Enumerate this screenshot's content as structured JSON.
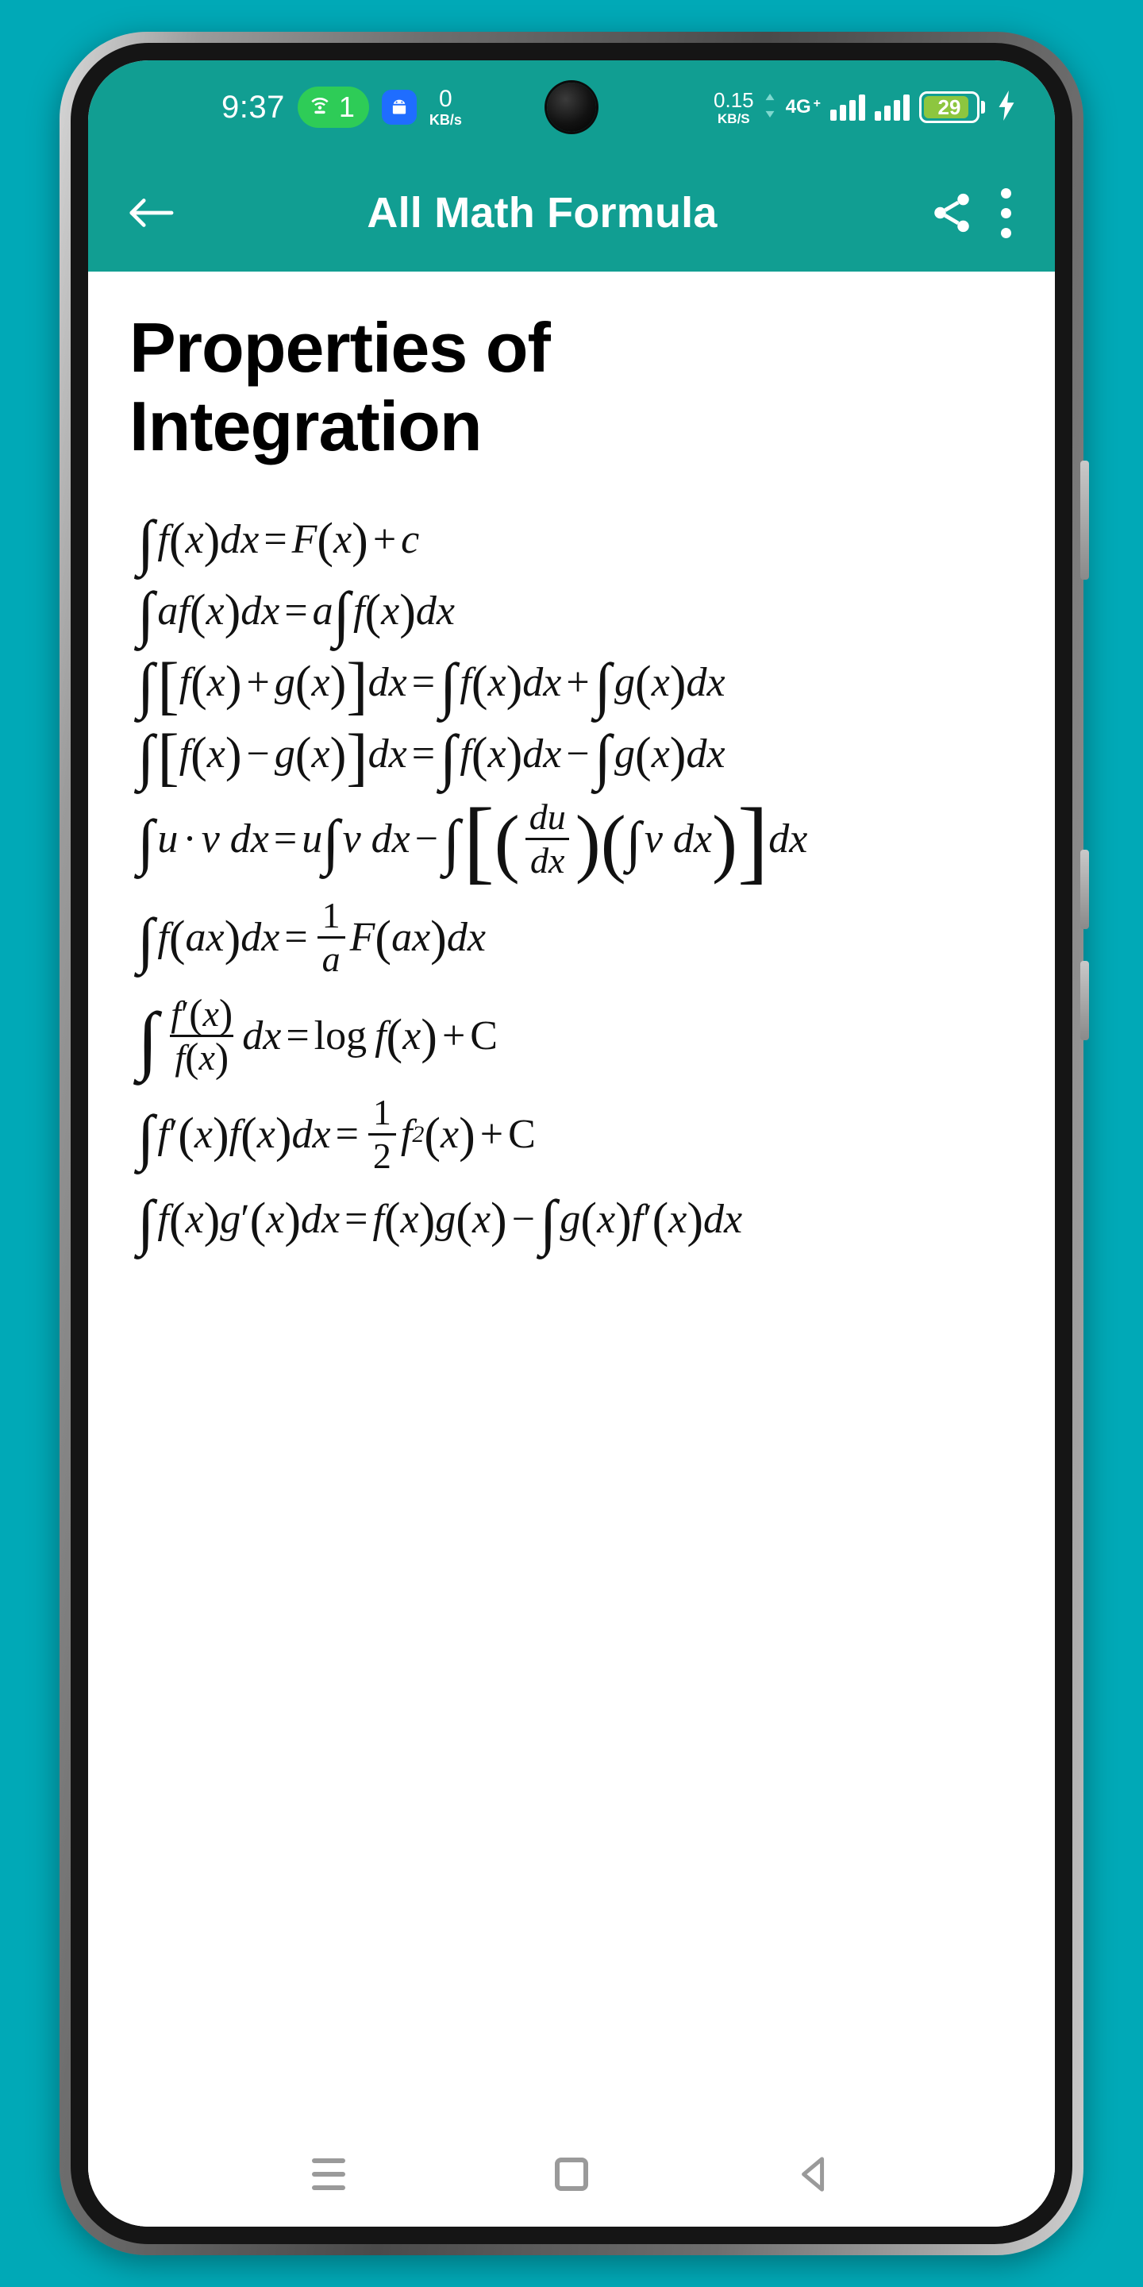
{
  "status_bar": {
    "clock": "9:37",
    "hotspot_icon": "wifi-hotspot-icon",
    "hotspot_connected_count": "1",
    "android_icon": "android-robot-icon",
    "left_net_speed_value": "0",
    "left_net_speed_unit": "KB/s",
    "right_net_speed_value": "0.15",
    "right_net_speed_unit": "KB/S",
    "network_type": "4G",
    "network_type_plus": "+",
    "signal_icon_1": "signal-bars-icon",
    "signal_icon_2": "signal-bars-icon",
    "battery_level": "29",
    "charging_icon": "charging-bolt-icon",
    "camera_icon": "front-camera-punch-hole"
  },
  "app_bar": {
    "back_icon": "back-arrow-icon",
    "title": "All Math Formula",
    "share_icon": "share-icon",
    "overflow_icon": "overflow-menu-icon"
  },
  "content": {
    "page_title": "Properties of Integration",
    "formulas": [
      {
        "id": "indefinite-integral-definition",
        "text": "∫f(x)dx = F(x) + c"
      },
      {
        "id": "constant-multiple-rule",
        "text": "∫af(x)dx = a∫f(x)dx"
      },
      {
        "id": "sum-rule",
        "text": "∫[f(x) + g(x)]dx = ∫f(x)dx + ∫g(x)dx"
      },
      {
        "id": "difference-rule",
        "text": "∫[f(x) − g(x)]dx = ∫f(x)dx − ∫g(x)dx"
      },
      {
        "id": "integration-by-parts-uv",
        "text": "∫u·v dx = u∫v dx − ∫[(du/dx)(∫v dx)]dx"
      },
      {
        "id": "linear-substitution-rule",
        "text": "∫f(ax)dx = (1/a)F(ax)dx"
      },
      {
        "id": "logarithmic-integral-rule",
        "text": "∫(f′(x)/f(x))dx = log f(x) + C"
      },
      {
        "id": "derivative-times-function-rule",
        "text": "∫f′(x)f(x)dx = (1/2)f²(x) + C"
      },
      {
        "id": "integration-by-parts-fg",
        "text": "∫f(x)g′(x)dx = f(x)g(x) − ∫g(x)f′(x)dx"
      }
    ]
  },
  "nav_bar": {
    "recents_icon": "recents-menu-icon",
    "home_icon": "home-square-icon",
    "back_icon": "back-triangle-icon"
  },
  "colors": {
    "accent": "#119e92",
    "backdrop": "#00a9b7",
    "hotspot_green": "#2ecc57",
    "android_blue": "#1f6dff",
    "battery_green": "#8dc63f",
    "page_background": "#ffffff"
  }
}
